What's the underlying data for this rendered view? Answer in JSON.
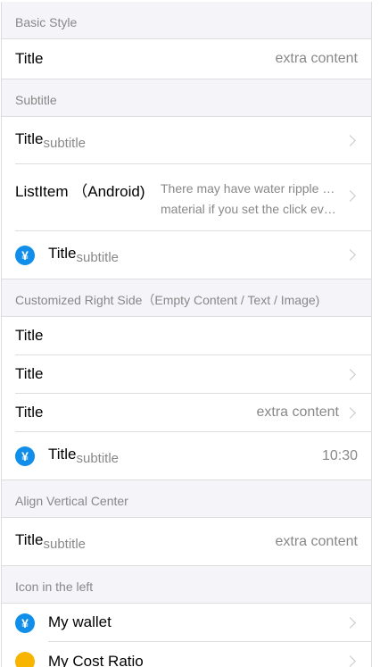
{
  "sections": {
    "basic": {
      "header": "Basic Style",
      "items": [
        {
          "title": "Title",
          "extra": "extra content"
        }
      ]
    },
    "subtitle": {
      "header": "Subtitle",
      "items": [
        {
          "title": "Title",
          "subtitle": "subtitle"
        },
        {
          "title": "ListItem （Android)",
          "extra_line1": "There may have water ripple effect of",
          "extra_line2": "material if you set the click event."
        },
        {
          "title": "Title",
          "subtitle": "subtitle",
          "icon": "yen-icon"
        }
      ]
    },
    "custom_right": {
      "header": "Customized Right Side（Empty Content / Text / Image)",
      "items": [
        {
          "title": "Title"
        },
        {
          "title": "Title"
        },
        {
          "title": "Title",
          "extra": "extra content"
        },
        {
          "title": "Title",
          "subtitle": "subtitle",
          "extra": "10:30",
          "icon": "yen-icon"
        }
      ]
    },
    "align_center": {
      "header": "Align Vertical Center",
      "items": [
        {
          "title": "Title",
          "subtitle": "subtitle",
          "extra": "extra content"
        }
      ]
    },
    "icon_left": {
      "header": "Icon in the left",
      "items": [
        {
          "title": "My wallet",
          "icon": "yen-icon"
        },
        {
          "title": "My Cost Ratio",
          "icon": "pie-chart-icon"
        }
      ]
    }
  },
  "icons": {
    "yen_glyph": "¥",
    "accent_blue": "#108ee9",
    "accent_orange": "#f7b500"
  }
}
